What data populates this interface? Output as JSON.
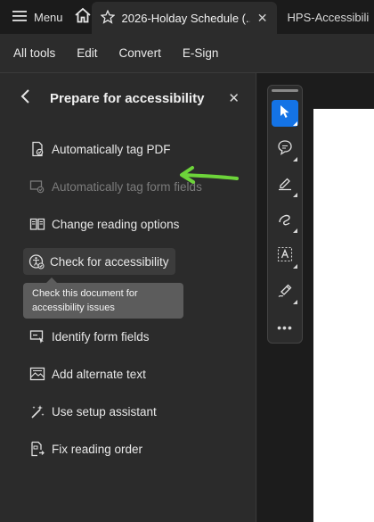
{
  "tabbar": {
    "menu_label": "Menu",
    "active_tab_title": "2026-Holday Schedule (...",
    "inactive_tab_title": "HPS-Accessibili"
  },
  "toolbar": {
    "items": [
      "All tools",
      "Edit",
      "Convert",
      "E-Sign"
    ]
  },
  "panel": {
    "title": "Prepare for accessibility",
    "items": [
      {
        "label": "Automatically tag PDF",
        "icon": "tag-pdf-icon",
        "enabled": true
      },
      {
        "label": "Automatically tag form fields",
        "icon": "tag-form-fields-icon",
        "enabled": false
      },
      {
        "label": "Change reading options",
        "icon": "reading-options-icon",
        "enabled": true
      },
      {
        "label": "Check for accessibility",
        "icon": "accessibility-check-icon",
        "enabled": true,
        "hovered": true
      },
      {
        "label": "Identify form fields",
        "icon": "form-fields-icon",
        "enabled": true
      },
      {
        "label": "Add alternate text",
        "icon": "alt-text-icon",
        "enabled": true
      },
      {
        "label": "Use setup assistant",
        "icon": "setup-assistant-icon",
        "enabled": true
      },
      {
        "label": "Fix reading order",
        "icon": "reading-order-icon",
        "enabled": true
      }
    ],
    "tooltip": "Check this document for accessibility issues"
  },
  "vertical_tools": [
    "select-pointer-icon",
    "comment-icon",
    "highlight-pen-icon",
    "freehand-draw-icon",
    "text-select-icon",
    "signature-icon",
    "more-icon"
  ],
  "colors": {
    "accent": "#1473e6",
    "annotation_arrow": "#6dd43a"
  }
}
